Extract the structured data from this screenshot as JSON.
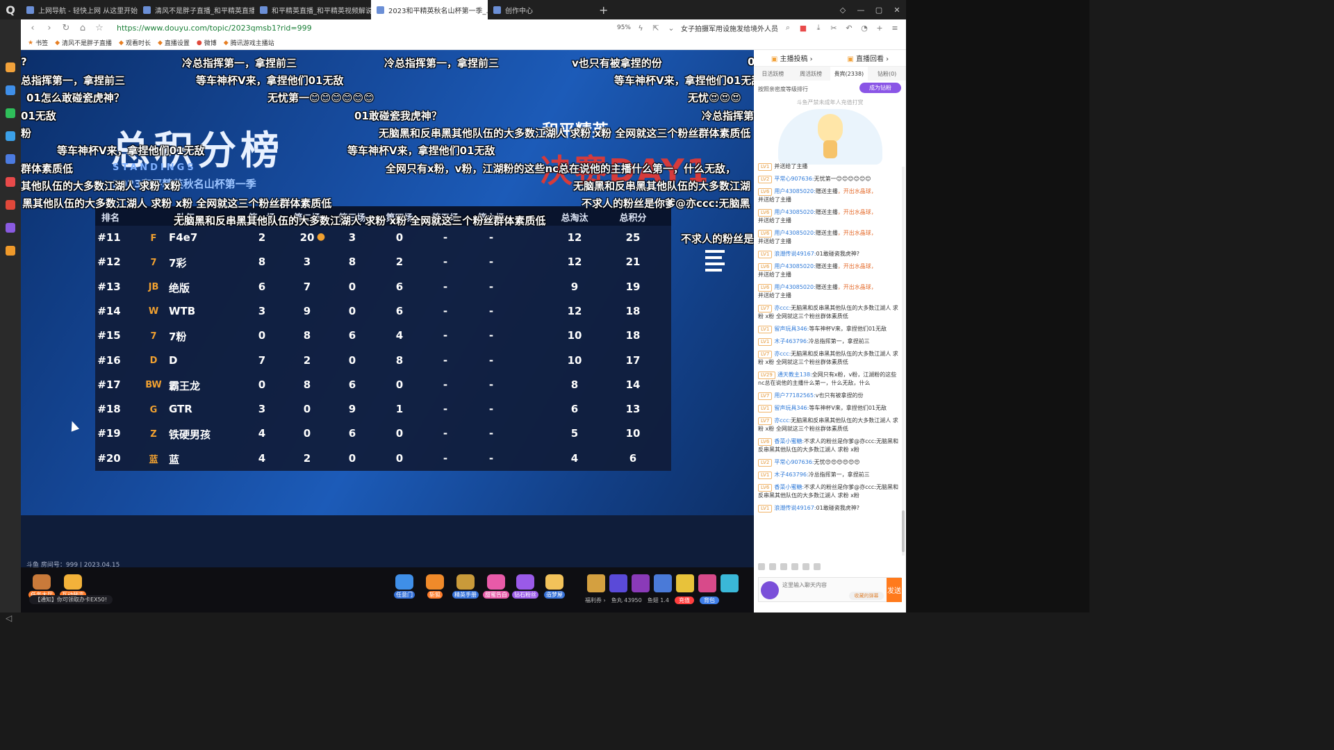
{
  "browser": {
    "tabs": [
      {
        "label": "上网导航 - 轻快上网 从这里开始",
        "active": false
      },
      {
        "label": "清风不是胖子直播_和平精英直播_斗鱼",
        "active": false
      },
      {
        "label": "和平精英直播_和平精英视频解说攻略",
        "active": false
      },
      {
        "label": "2023和平精英秋名山杯第一季_...",
        "active": true
      },
      {
        "label": "创作中心",
        "active": false
      }
    ],
    "url": "https://www.douyu.com/topic/2023qmsb1?rid=999",
    "zoom": "95%",
    "news_ticker": "女子拍摄军用设施发给境外人员",
    "bookmarks": [
      "书签",
      "清风不是胖子直播",
      "观看时长",
      "直播设置",
      "微博",
      "腾讯游戏主播站"
    ]
  },
  "stream": {
    "title_cn": "总积分榜",
    "title_en": "STANDINGS",
    "event_name": "2023和平精英秋名山杯第一季",
    "final_label": "决赛DAY1",
    "brand": "和平精英",
    "room_info": "斗鱼 房间号：999 | 2023.04.15",
    "danmaku": [
      {
        "text": "?"
      },
      {
        "text": "冷总指挥第一，拿捏前三"
      },
      {
        "text": "冷总指挥第一，拿捏前三"
      },
      {
        "text": "v也只有被拿捏的份"
      },
      {
        "text": "0"
      },
      {
        "text": "总指挥第一，拿捏前三"
      },
      {
        "text": "等车神杯V来，拿捏他们01无敌"
      },
      {
        "text": "等车神杯V来，拿捏他们01无敌"
      },
      {
        "text": "01怎么敢碰瓷虎神？"
      },
      {
        "text": "无忧第一😊😊😊😊😊😊"
      },
      {
        "text": "无忧😍😍😍"
      },
      {
        "text": "01无敌"
      },
      {
        "text": "01敢碰瓷我虎神？"
      },
      {
        "text": "冷总指挥第一"
      },
      {
        "text": "粉"
      },
      {
        "text": "无脑黑和反串黑其他队伍的大多数江湖人 求粉 x粉 全网就这三个粉丝群体素质低"
      },
      {
        "text": "等车神杯V来，拿捏他们01无敌"
      },
      {
        "text": "等车神杯V来，拿捏他们01无敌"
      },
      {
        "text": "群体素质低"
      },
      {
        "text": "全网只有x粉，v粉，江湖粉的这些nc总在说他的主播什么第一，什么无敌，"
      },
      {
        "text": "其他队伍的大多数江湖人 求粉 x粉"
      },
      {
        "text": "无脑黑和反串黑其他队伍的大多数江湖"
      },
      {
        "text": "黑其他队伍的大多数江湖人 求粉 x粉 全网就这三个粉丝群体素质低"
      },
      {
        "text": "不求人的粉丝是你爹@亦ccc:无脑黑"
      },
      {
        "text": "无脑黑和反串黑其他队伍的大多数江湖人 求粉 x粉 全网就这三个粉丝群体素质低"
      },
      {
        "text": "不求人的粉丝是"
      }
    ],
    "standings": {
      "headers": [
        "排名",
        "队伍",
        "第一场",
        "第二场",
        "第三场",
        "第四场",
        "第五场",
        "第六场",
        "总淘汰",
        "总积分"
      ],
      "rows": [
        {
          "rank": "#11",
          "logo": "F",
          "team": "F4e7",
          "g1": "2",
          "g2": "20",
          "g3": "3",
          "g4": "0",
          "g5": "-",
          "g6": "-",
          "elims": "12",
          "total": "25",
          "medal": true
        },
        {
          "rank": "#12",
          "logo": "7",
          "team": "7彩",
          "g1": "8",
          "g2": "3",
          "g3": "8",
          "g4": "2",
          "g5": "-",
          "g6": "-",
          "elims": "12",
          "total": "21",
          "medal": false
        },
        {
          "rank": "#13",
          "logo": "JB",
          "team": "绝版",
          "g1": "6",
          "g2": "7",
          "g3": "0",
          "g4": "6",
          "g5": "-",
          "g6": "-",
          "elims": "9",
          "total": "19",
          "medal": false
        },
        {
          "rank": "#14",
          "logo": "W",
          "team": "WTB",
          "g1": "3",
          "g2": "9",
          "g3": "0",
          "g4": "6",
          "g5": "-",
          "g6": "-",
          "elims": "12",
          "total": "18",
          "medal": false
        },
        {
          "rank": "#15",
          "logo": "7",
          "team": "7粉",
          "g1": "0",
          "g2": "8",
          "g3": "6",
          "g4": "4",
          "g5": "-",
          "g6": "-",
          "elims": "10",
          "total": "18",
          "medal": false
        },
        {
          "rank": "#16",
          "logo": "D",
          "team": "D",
          "g1": "7",
          "g2": "2",
          "g3": "0",
          "g4": "8",
          "g5": "-",
          "g6": "-",
          "elims": "10",
          "total": "17",
          "medal": false
        },
        {
          "rank": "#17",
          "logo": "BW",
          "team": "霸王龙",
          "g1": "0",
          "g2": "8",
          "g3": "6",
          "g4": "0",
          "g5": "-",
          "g6": "-",
          "elims": "8",
          "total": "14",
          "medal": false
        },
        {
          "rank": "#18",
          "logo": "G",
          "team": "GTR",
          "g1": "3",
          "g2": "0",
          "g3": "9",
          "g4": "1",
          "g5": "-",
          "g6": "-",
          "elims": "6",
          "total": "13",
          "medal": false
        },
        {
          "rank": "#19",
          "logo": "Z",
          "team": "铁硬男孩",
          "g1": "4",
          "g2": "0",
          "g3": "6",
          "g4": "0",
          "g5": "-",
          "g6": "-",
          "elims": "5",
          "total": "10",
          "medal": false
        },
        {
          "rank": "#20",
          "logo": "蓝",
          "team": "蓝",
          "g1": "4",
          "g2": "2",
          "g3": "0",
          "g4": "0",
          "g5": "-",
          "g6": "-",
          "elims": "4",
          "total": "6",
          "medal": false
        }
      ]
    }
  },
  "right_panel": {
    "top_links": [
      "主播投稿 ›",
      "直播回看 ›"
    ],
    "rank_tabs": [
      "日活跃榜",
      "周活跃榜",
      "贵宾(2338)",
      "钻粉(0)"
    ],
    "rank_info": "按照亲密度等级排行",
    "fan_button": "成为钻粉",
    "notice": "斗鱼严禁未成年人充值打赏",
    "chat": [
      {
        "lv": "LV1",
        "nick": "",
        "text": "并送给了主播"
      },
      {
        "lv": "LV2",
        "nick": "平常心907636:",
        "text": "无忧第一😊😊😊😊😊😊"
      },
      {
        "lv": "LV6",
        "nick": "用户43085020:",
        "text": "赠送主播",
        "gift": "，开出水晶球，",
        "tail": "并送给了主播"
      },
      {
        "lv": "LV6",
        "nick": "用户43085020:",
        "text": "赠送主播",
        "gift": "，开出水晶球，",
        "tail": "并送给了主播"
      },
      {
        "lv": "LV6",
        "nick": "用户43085020:",
        "text": "赠送主播",
        "gift": "，开出水晶球，",
        "tail": "并送给了主播"
      },
      {
        "lv": "LV1",
        "nick": "浪潮传说49167:",
        "text": "01敢碰瓷我虎神?"
      },
      {
        "lv": "LV6",
        "nick": "用户43085020:",
        "text": "赠送主播",
        "gift": "，开出水晶球，",
        "tail": "并送给了主播"
      },
      {
        "lv": "LV6",
        "nick": "用户43085020:",
        "text": "赠送主播",
        "gift": "，开出水晶球，",
        "tail": "并送给了主播"
      },
      {
        "lv": "LV7",
        "nick": "亦ccc:",
        "text": "无脑黑和反串黑其他队伍的大多数江湖人 求粉 x粉 全网就这三个粉丝群体素质低"
      },
      {
        "lv": "LV1",
        "nick": "留声玩具346:",
        "text": "等车神杯V来，拿捏他们01无敌"
      },
      {
        "lv": "LV1",
        "nick": "木子463796:",
        "text": "冷总指挥第一，拿捏前三"
      },
      {
        "lv": "LV7",
        "nick": "亦ccc:",
        "text": "无脑黑和反串黑其他队伍的大多数江湖人 求粉 x粉 全网就这三个粉丝群体素质低"
      },
      {
        "lv": "LV29",
        "nick": "通天教主138:",
        "text": "全网只有x粉，v粉，江湖粉的这些nc总在说他的主播什么第一，什么无敌，什么"
      },
      {
        "lv": "LV7",
        "nick": "用户77182565:",
        "text": "v也只有被拿捏的份"
      },
      {
        "lv": "LV1",
        "nick": "留声玩具346:",
        "text": "等车神杯V来，拿捏他们01无敌"
      },
      {
        "lv": "LV7",
        "nick": "亦ccc:",
        "text": "无脑黑和反串黑其他队伍的大多数江湖人 求粉 x粉 全网就这三个粉丝群体素质低"
      },
      {
        "lv": "LV6",
        "nick": "香菜小蜜糖:",
        "text": "不求人的粉丝是你爹@亦ccc:无脑黑和反串黑其他队伍的大多数江湖人 求粉 x粉"
      },
      {
        "lv": "LV2",
        "nick": "平常心907636:",
        "text": "无忧😍😍😍😍😍😍"
      },
      {
        "lv": "LV1",
        "nick": "木子463796:",
        "text": "冷总指挥第一，拿捏前三"
      },
      {
        "lv": "LV6",
        "nick": "香菜小蜜糖:",
        "text": "不求人的粉丝是你爹@亦ccc:无脑黑和反串黑其他队伍的大多数江湖人 求粉 x粉"
      },
      {
        "lv": "LV1",
        "nick": "浪潮传说49167:",
        "text": "01敢碰瓷我虎神?"
      }
    ],
    "input_placeholder": "这里输入聊天内容",
    "collect_label": "收藏的弹幕",
    "send_label": "发送"
  },
  "giftbar": {
    "left_items": [
      {
        "label": "任务大厅"
      },
      {
        "label": "互动预言"
      }
    ],
    "center_items": [
      {
        "label": "任意门",
        "badge": "new"
      },
      {
        "label": "斩狐"
      },
      {
        "label": "精英手册"
      },
      {
        "label": "甜蜜告白"
      },
      {
        "label": "钻石粉丝"
      },
      {
        "label": "造梦屋"
      }
    ],
    "notice": "【通知】你可领取办卡EX50!",
    "wallet": {
      "perks": "福利券 ›",
      "fish_ball": "鱼丸 43950",
      "fish_wing": "鱼翅 1.4",
      "recharge": "充值",
      "backpack": "背包"
    }
  },
  "colors": {
    "video_bg": "#164a9c",
    "final_red": "#d63b3b",
    "accent_orange": "#ff7a1c",
    "fan_purple": "#8a55e6",
    "nick_blue": "#2f7ad8"
  }
}
